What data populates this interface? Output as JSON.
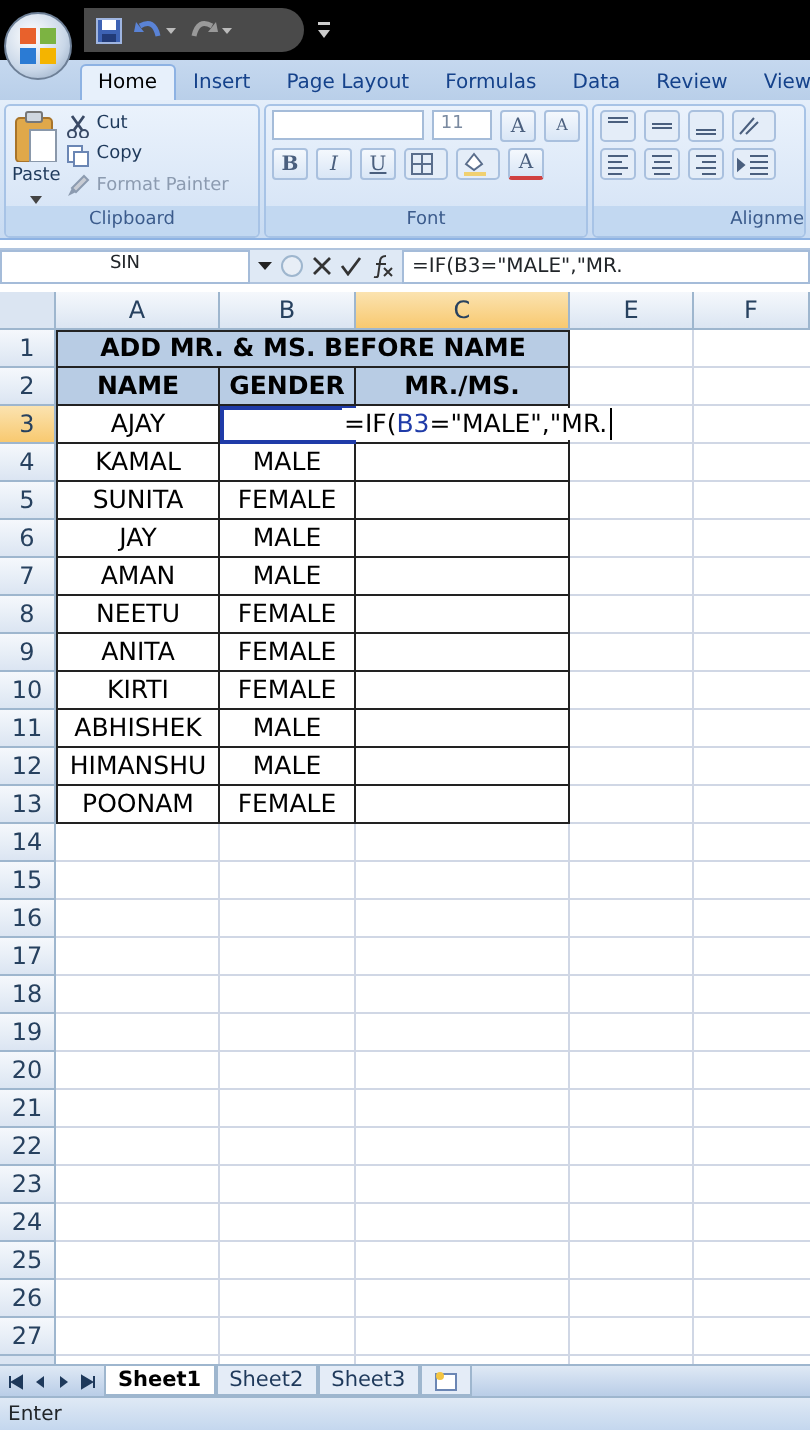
{
  "ribbon_tabs": [
    {
      "label": "Home",
      "selected": true
    },
    {
      "label": "Insert",
      "selected": false
    },
    {
      "label": "Page Layout",
      "selected": false
    },
    {
      "label": "Formulas",
      "selected": false
    },
    {
      "label": "Data",
      "selected": false
    },
    {
      "label": "Review",
      "selected": false
    },
    {
      "label": "View",
      "selected": false
    }
  ],
  "clipboard": {
    "paste": "Paste",
    "items": [
      {
        "kind": "cut",
        "label": "Cut",
        "disabled": false
      },
      {
        "kind": "copy",
        "label": "Copy",
        "disabled": false
      },
      {
        "kind": "painter",
        "label": "Format Painter",
        "disabled": true
      }
    ],
    "group_label": "Clipboard"
  },
  "font": {
    "size": "11",
    "grow": "A",
    "shrink": "A",
    "styles": [
      {
        "kind": "bold",
        "label": "B"
      },
      {
        "kind": "italic",
        "label": "I"
      },
      {
        "kind": "underline",
        "label": "U"
      }
    ],
    "font_color": "A",
    "group_label": "Font"
  },
  "alignment": {
    "group_label": "Alignme"
  },
  "formula_bar": {
    "name_box": "SIN",
    "formula": "=IF(B3=\"MALE\",\"MR."
  },
  "columns": [
    {
      "label": "A",
      "selected": false
    },
    {
      "label": "B",
      "selected": false
    },
    {
      "label": "C",
      "selected": true
    },
    {
      "label": "E",
      "selected": false
    },
    {
      "label": "F",
      "selected": false
    }
  ],
  "row_numbers": [
    {
      "label": "1",
      "selected": false
    },
    {
      "label": "2",
      "selected": false
    },
    {
      "label": "3",
      "selected": true
    },
    {
      "label": "4",
      "selected": false
    },
    {
      "label": "5",
      "selected": false
    },
    {
      "label": "6",
      "selected": false
    },
    {
      "label": "7",
      "selected": false
    },
    {
      "label": "8",
      "selected": false
    },
    {
      "label": "9",
      "selected": false
    },
    {
      "label": "10",
      "selected": false
    },
    {
      "label": "11",
      "selected": false
    },
    {
      "label": "12",
      "selected": false
    },
    {
      "label": "13",
      "selected": false
    },
    {
      "label": "14",
      "selected": false
    },
    {
      "label": "15",
      "selected": false
    },
    {
      "label": "16",
      "selected": false
    },
    {
      "label": "17",
      "selected": false
    },
    {
      "label": "18",
      "selected": false
    },
    {
      "label": "19",
      "selected": false
    },
    {
      "label": "20",
      "selected": false
    },
    {
      "label": "21",
      "selected": false
    },
    {
      "label": "22",
      "selected": false
    },
    {
      "label": "23",
      "selected": false
    },
    {
      "label": "24",
      "selected": false
    },
    {
      "label": "25",
      "selected": false
    },
    {
      "label": "26",
      "selected": false
    },
    {
      "label": "27",
      "selected": false
    }
  ],
  "title": "ADD MR. & MS. BEFORE NAME",
  "headers": [
    "NAME",
    "GENDER",
    "MR./MS."
  ],
  "records": [
    {
      "name": "AJAY",
      "referenced": true,
      "formula_parts": [
        {
          "kind": "plain",
          "text": "=IF("
        },
        {
          "kind": "ref",
          "text": "B3"
        },
        {
          "kind": "plain",
          "text": "=\"MALE\",\"MR."
        }
      ]
    },
    {
      "name": "KAMAL",
      "gender": "MALE",
      "referenced": false
    },
    {
      "name": "SUNITA",
      "gender": "FEMALE",
      "referenced": false
    },
    {
      "name": "JAY",
      "gender": "MALE",
      "referenced": false
    },
    {
      "name": "AMAN",
      "gender": "MALE",
      "referenced": false
    },
    {
      "name": "NEETU",
      "gender": "FEMALE",
      "referenced": false
    },
    {
      "name": "ANITA",
      "gender": "FEMALE",
      "referenced": false
    },
    {
      "name": "KIRTI",
      "gender": "FEMALE",
      "referenced": false
    },
    {
      "name": "ABHISHEK",
      "gender": "MALE",
      "referenced": false
    },
    {
      "name": "HIMANSHU",
      "gender": "MALE",
      "referenced": false
    },
    {
      "name": "POONAM",
      "gender": "FEMALE",
      "referenced": false
    }
  ],
  "sheet_tabs": [
    {
      "label": "Sheet1",
      "selected": true
    },
    {
      "label": "Sheet2",
      "selected": false
    },
    {
      "label": "Sheet3",
      "selected": false
    }
  ],
  "status_bar": {
    "mode": "Enter"
  }
}
